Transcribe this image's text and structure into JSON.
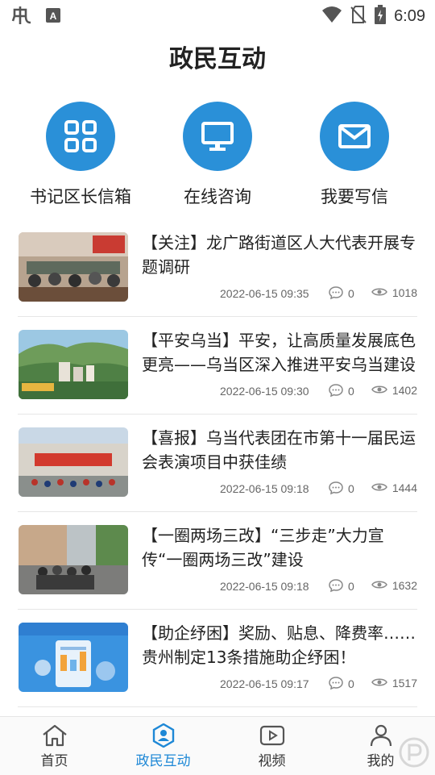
{
  "status_bar": {
    "time": "6:09"
  },
  "page_title": "政民互动",
  "quick_actions": [
    {
      "label": "书记区长信箱",
      "icon": "grid-icon"
    },
    {
      "label": "在线咨询",
      "icon": "monitor-icon"
    },
    {
      "label": "我要写信",
      "icon": "envelope-icon"
    }
  ],
  "news": [
    {
      "title": "【关注】龙广路街道区人大代表开展专题调研",
      "date": "2022-06-15 09:35",
      "comments": "0",
      "views": "1018"
    },
    {
      "title": "【平安乌当】平安，让高质量发展底色更亮——乌当区深入推进平安乌当建设",
      "date": "2022-06-15 09:30",
      "comments": "0",
      "views": "1402"
    },
    {
      "title": "【喜报】乌当代表团在市第十一届民运会表演项目中获佳绩",
      "date": "2022-06-15 09:18",
      "comments": "0",
      "views": "1444"
    },
    {
      "title": "【一圈两场三改】“三步走”大力宣传“一圈两场三改”建设",
      "date": "2022-06-15 09:18",
      "comments": "0",
      "views": "1632"
    },
    {
      "title": "【助企纾困】奖励、贴息、降费率……贵州制定13条措施助企纾困！",
      "date": "2022-06-15 09:17",
      "comments": "0",
      "views": "1517"
    }
  ],
  "tabs": [
    {
      "label": "首页",
      "icon": "home-icon"
    },
    {
      "label": "政民互动",
      "icon": "hexagon-user-icon",
      "active": true
    },
    {
      "label": "视频",
      "icon": "video-icon"
    },
    {
      "label": "我的",
      "icon": "user-icon"
    }
  ],
  "colors": {
    "accent": "#1e88d6",
    "circle": "#2a90d8"
  }
}
